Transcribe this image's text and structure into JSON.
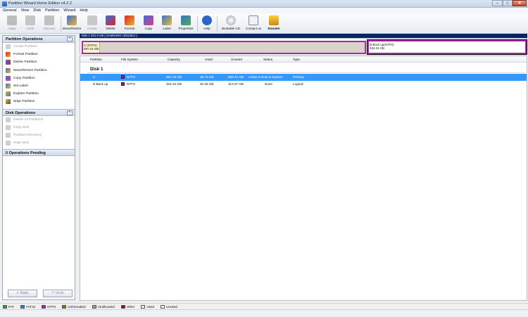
{
  "window": {
    "title": "Partition Wizard Home Edition v4.2.2"
  },
  "menu": [
    "General",
    "View",
    "Disk",
    "Partition",
    "Wizard",
    "Help"
  ],
  "toolbar": [
    {
      "label": "Apply",
      "icon": "apply-icon",
      "disabled": true
    },
    {
      "label": "Undo",
      "icon": "undo-icon",
      "disabled": true
    },
    {
      "label": "Discard",
      "icon": "discard-icon",
      "disabled": true
    },
    {
      "label": "Move/Resize",
      "icon": "move-resize-icon",
      "disabled": false
    },
    {
      "label": "Create",
      "icon": "create-icon",
      "disabled": true
    },
    {
      "label": "Delete",
      "icon": "delete-icon",
      "disabled": false
    },
    {
      "label": "Format",
      "icon": "format-icon",
      "disabled": false
    },
    {
      "label": "Copy",
      "icon": "copy-icon",
      "disabled": false
    },
    {
      "label": "Label",
      "icon": "label-icon",
      "disabled": false
    },
    {
      "label": "Properties",
      "icon": "properties-icon",
      "disabled": false
    },
    {
      "label": "Help",
      "icon": "help-icon",
      "disabled": false
    },
    {
      "label": "Bootable CD",
      "icon": "bootable-cd-icon",
      "disabled": false
    },
    {
      "label": "Contact us",
      "icon": "contact-icon",
      "disabled": false
    },
    {
      "label": "Donate!",
      "icon": "donate-icon",
      "disabled": false
    }
  ],
  "sidebar": {
    "partition_ops_title": "Partition Operations",
    "partition_ops": [
      {
        "label": "Create Partition",
        "disabled": true
      },
      {
        "label": "Format Partition",
        "disabled": false
      },
      {
        "label": "Delete Partition",
        "disabled": false
      },
      {
        "label": "Move/Resize Partition",
        "disabled": false
      },
      {
        "label": "Copy Partition",
        "disabled": false
      },
      {
        "label": "Set Label",
        "disabled": false
      },
      {
        "label": "Explore Partition",
        "disabled": false
      },
      {
        "label": "Wipe Partition",
        "disabled": false
      }
    ],
    "disk_ops_title": "Disk Operations",
    "disk_ops": [
      {
        "label": "Delete All Partitions",
        "disabled": true
      },
      {
        "label": "Copy Disk",
        "disabled": true
      },
      {
        "label": "Partition Recovery",
        "disabled": true
      },
      {
        "label": "Wipe Disk",
        "disabled": true
      }
    ],
    "pending": "0 Operations Pending",
    "apply_label": "Apply",
    "undo_label": "Undo"
  },
  "disk": {
    "header": "Disk 1 931.5 GB  [ SAMSUNG HD103UJ ]",
    "map": {
      "c_name": "C:(NTFS)",
      "c_size": "597.16 GB",
      "d_name": "D:Back up(NTFS)",
      "d_size": "334.34 GB"
    }
  },
  "table": {
    "columns": [
      "Partition",
      "File System",
      "Capacity",
      "Used",
      "Unused",
      "Status",
      "Type"
    ],
    "group": "Disk 1",
    "rows": [
      {
        "partition": "C:",
        "fs": "NTFS",
        "capacity": "597.16 GB",
        "used": "38.75 GB",
        "unused": "558.42 GB",
        "status": "Active & Boot & System",
        "type": "Primary"
      },
      {
        "partition": "D:Back up",
        "fs": "NTFS",
        "capacity": "334.34 GB",
        "used": "20.36 GB",
        "unused": "313.97 GB",
        "status": "None",
        "type": "Logical"
      }
    ]
  },
  "legend": [
    {
      "label": "FAT",
      "color": "#22aa22"
    },
    {
      "label": "FAT32",
      "color": "#2f7fd8"
    },
    {
      "label": "NTFS",
      "color": "#a020a0"
    },
    {
      "label": "Unformatted",
      "color": "#7b7b10"
    },
    {
      "label": "Unallocated",
      "color": "#9a9a9a"
    },
    {
      "label": "Other",
      "color": "#7a1010"
    },
    {
      "label": "Used",
      "color": "#f7f5d0"
    },
    {
      "label": "Unused",
      "color": "#ffffff"
    }
  ],
  "colors": {
    "selection": "#3399ff",
    "ntfs": "#a020a0",
    "disk_header": "#0a246a"
  }
}
